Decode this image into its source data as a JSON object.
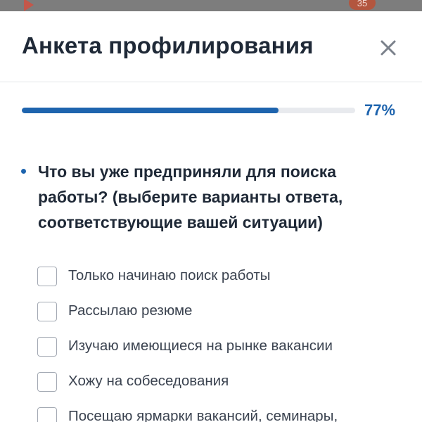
{
  "backdrop": {
    "badge_count": "35",
    "accent_color": "#c4574a"
  },
  "modal": {
    "title": "Анкета профилирования",
    "close_icon": "close-icon"
  },
  "progress": {
    "percent": 77,
    "label": "77%",
    "fill_color": "#1e64ae"
  },
  "question": {
    "text": "Что вы уже предприняли для поиска работы? (выберите варианты ответа, соответствующие вашей ситуации)",
    "options": [
      {
        "label": "Только начинаю поиск работы",
        "checked": false
      },
      {
        "label": "Рассылаю резюме",
        "checked": false
      },
      {
        "label": "Изучаю имеющиеся на рынке вакансии",
        "checked": false
      },
      {
        "label": "Хожу на собеседования",
        "checked": false
      },
      {
        "label": "Посещаю ярмарки вакансий, семинары,",
        "checked": false
      }
    ]
  }
}
